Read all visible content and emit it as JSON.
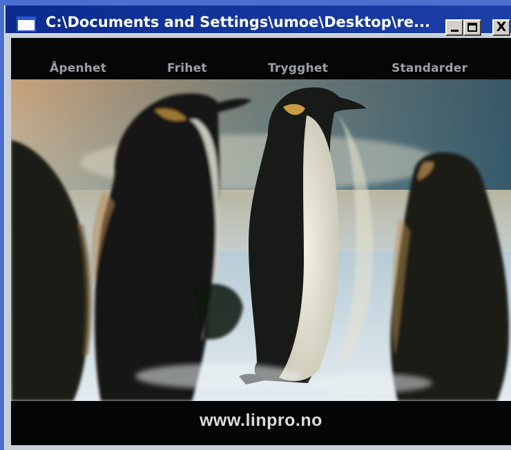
{
  "window": {
    "title": "C:\\Documents and Settings\\umoe\\Desktop\\re...",
    "minimize_symbol": "_",
    "maximize_symbol": "□",
    "close_symbol": "X"
  },
  "nav": {
    "items": [
      {
        "label": "Åpenhet"
      },
      {
        "label": "Frihet"
      },
      {
        "label": "Trygghet"
      },
      {
        "label": "Standarder"
      }
    ]
  },
  "footer": {
    "url": "www.linpro.no"
  },
  "colors": {
    "titlebar": "#0a2a8e",
    "desktop": "#4a6fd0",
    "nav_text": "#9aa0a6",
    "footer_text": "#dcdcdc"
  }
}
